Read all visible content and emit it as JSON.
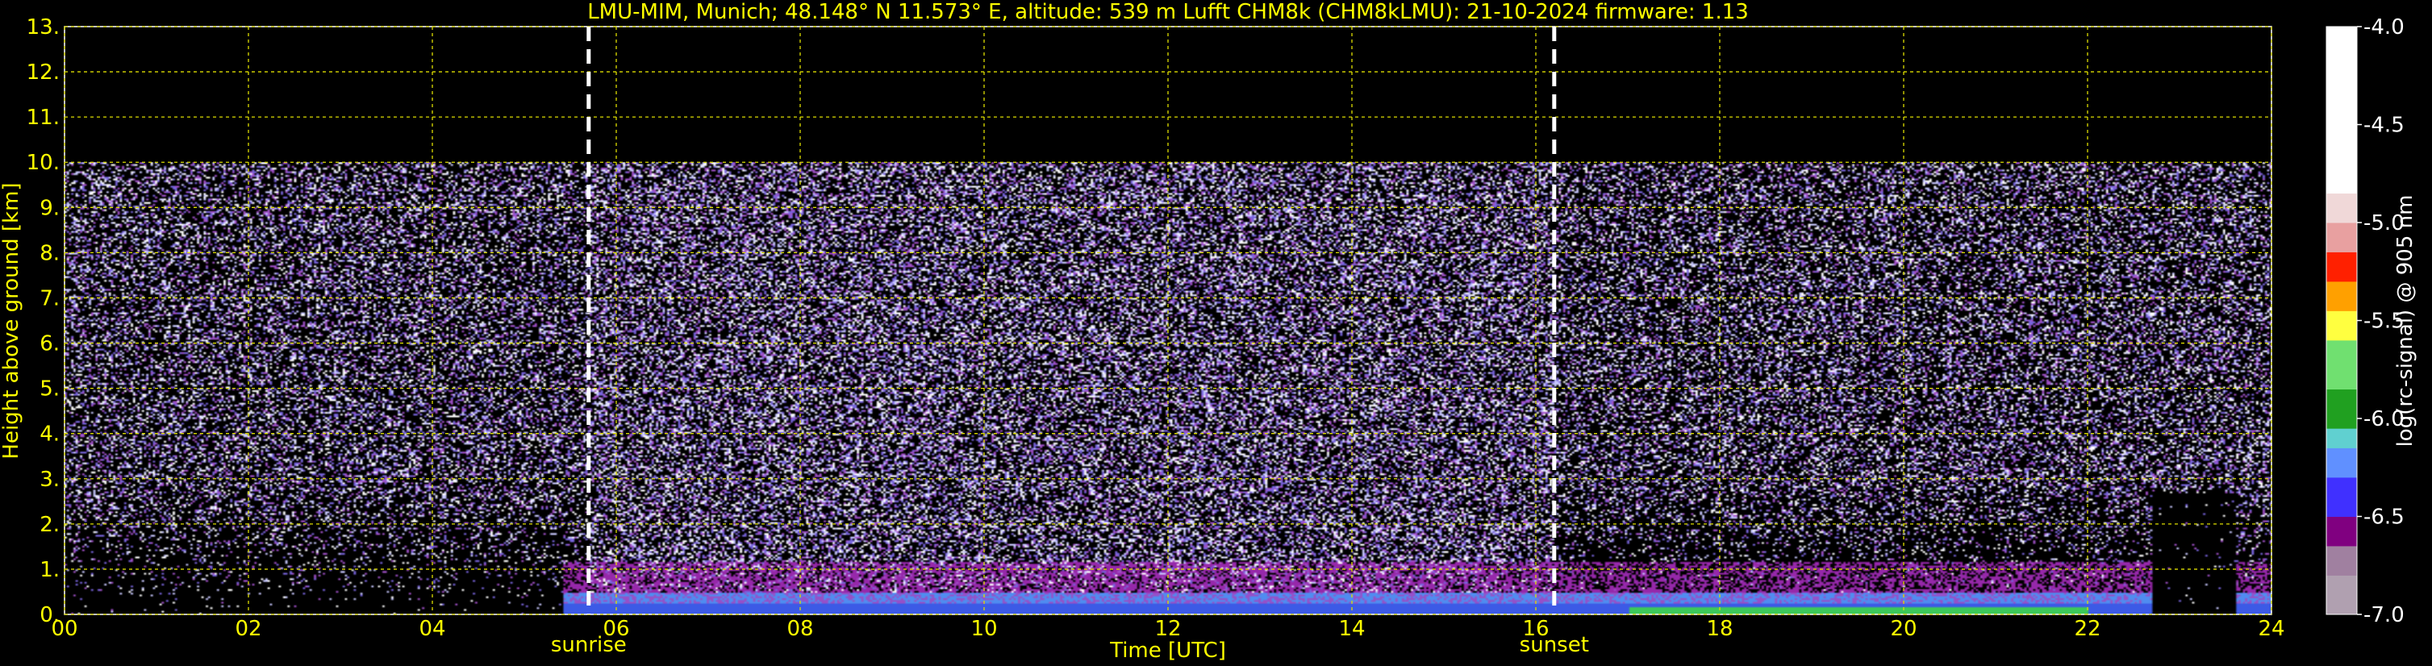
{
  "chart_data": {
    "type": "heatmap",
    "title": "LMU-MIM, Munich; 48.148° N 11.573° E, altitude: 539 m    Lufft CHM8k (CHM8kLMU): 21-10-2024    firmware: 1.13",
    "xlabel": "Time [UTC]",
    "ylabel": "Height above ground [km]",
    "xlim": [
      0,
      24
    ],
    "ylim": [
      0,
      13
    ],
    "x_tick_labels": [
      "00",
      "02",
      "04",
      "06",
      "08",
      "10",
      "12",
      "14",
      "16",
      "18",
      "20",
      "22",
      "24"
    ],
    "y_tick_labels": [
      "0.",
      "1.",
      "2.",
      "3.",
      "4.",
      "5.",
      "6.",
      "7.",
      "8.",
      "9.",
      "10.",
      "11.",
      "12.",
      "13."
    ],
    "grid": true,
    "measurement_top_km": 10,
    "events": [
      {
        "label": "sunrise",
        "time_h": 5.7
      },
      {
        "label": "sunset",
        "time_h": 16.2
      }
    ],
    "colorbar": {
      "label": "log(rc-signal) @ 905 nm",
      "range": [
        -7.0,
        -4.0
      ],
      "tick_labels": [
        "-4.0",
        "-4.5",
        "-5.0",
        "-5.5",
        "-6.0",
        "-6.5",
        "-7.0"
      ]
    }
  },
  "colors": {
    "text": "#ffff00",
    "grid": "#dcdc00",
    "background": "#000000"
  }
}
